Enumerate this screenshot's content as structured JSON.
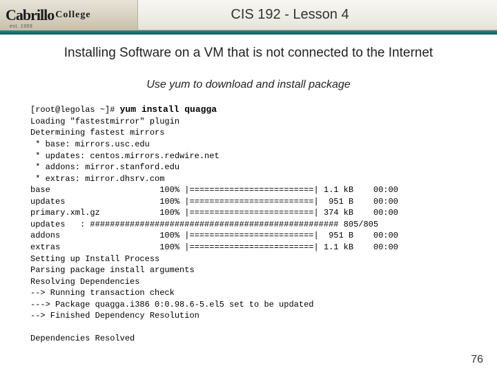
{
  "header": {
    "logo_script": "Cabrillo",
    "logo_wordmark": "College",
    "logo_est": "est. 1959",
    "title": "CIS 192 - Lesson 4"
  },
  "subtitle": "Installing Software on a VM that is not connected to the Internet",
  "instruction": "Use yum to download and install package",
  "terminal": {
    "prompt": "[root@legolas ~]# ",
    "command": "yum install quagga",
    "lines": [
      "Loading \"fastestmirror\" plugin",
      "Determining fastest mirrors",
      " * base: mirrors.usc.edu",
      " * updates: centos.mirrors.redwire.net",
      " * addons: mirror.stanford.edu",
      " * extras: mirror.dhsrv.com",
      "base                      100% |=========================| 1.1 kB    00:00",
      "updates                   100% |=========================|  951 B    00:00",
      "primary.xml.gz            100% |=========================| 374 kB    00:00",
      "updates   : ################################################## 805/805",
      "addons                    100% |=========================|  951 B    00:00",
      "extras                    100% |=========================| 1.1 kB    00:00",
      "Setting up Install Process",
      "Parsing package install arguments",
      "Resolving Dependencies",
      "--> Running transaction check",
      "---> Package quagga.i386 0:0.98.6-5.el5 set to be updated",
      "--> Finished Dependency Resolution",
      "",
      "Dependencies Resolved"
    ]
  },
  "page_number": "76"
}
